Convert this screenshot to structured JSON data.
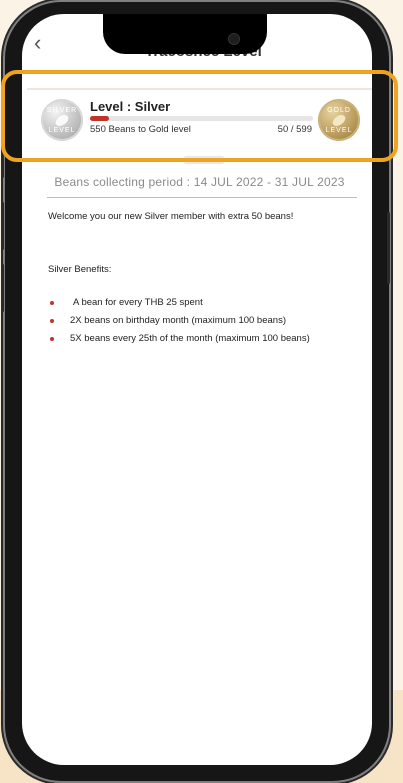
{
  "header": {
    "back_glyph": "‹",
    "title": "Tracoshee Level"
  },
  "level": {
    "title": "Level : Silver",
    "current_medal_label_top": "SILVER",
    "current_medal_label_bottom": "LEVEL",
    "next_medal_label_top": "GOLD",
    "next_medal_label_bottom": "LEVEL",
    "beans_to_next": "550 Beans to Gold level",
    "beans_count": "50 / 599",
    "progress_fraction": 0.083
  },
  "period": {
    "text": "Beans collecting period : 14 JUL 2022 - 31 JUL 2023"
  },
  "content": {
    "welcome": "Welcome you our new Silver member with extra 50 beans!",
    "benefits_title": "Silver Benefits:",
    "benefits": [
      "A bean for every THB 25 spent",
      "2X beans on birthday month (maximum 100 beans)",
      "5X beans every 25th of the month (maximum 100 beans)"
    ]
  },
  "colors": {
    "highlight_border": "#f0a321",
    "progress": "#c0342a",
    "bullet": "#c0342a"
  }
}
